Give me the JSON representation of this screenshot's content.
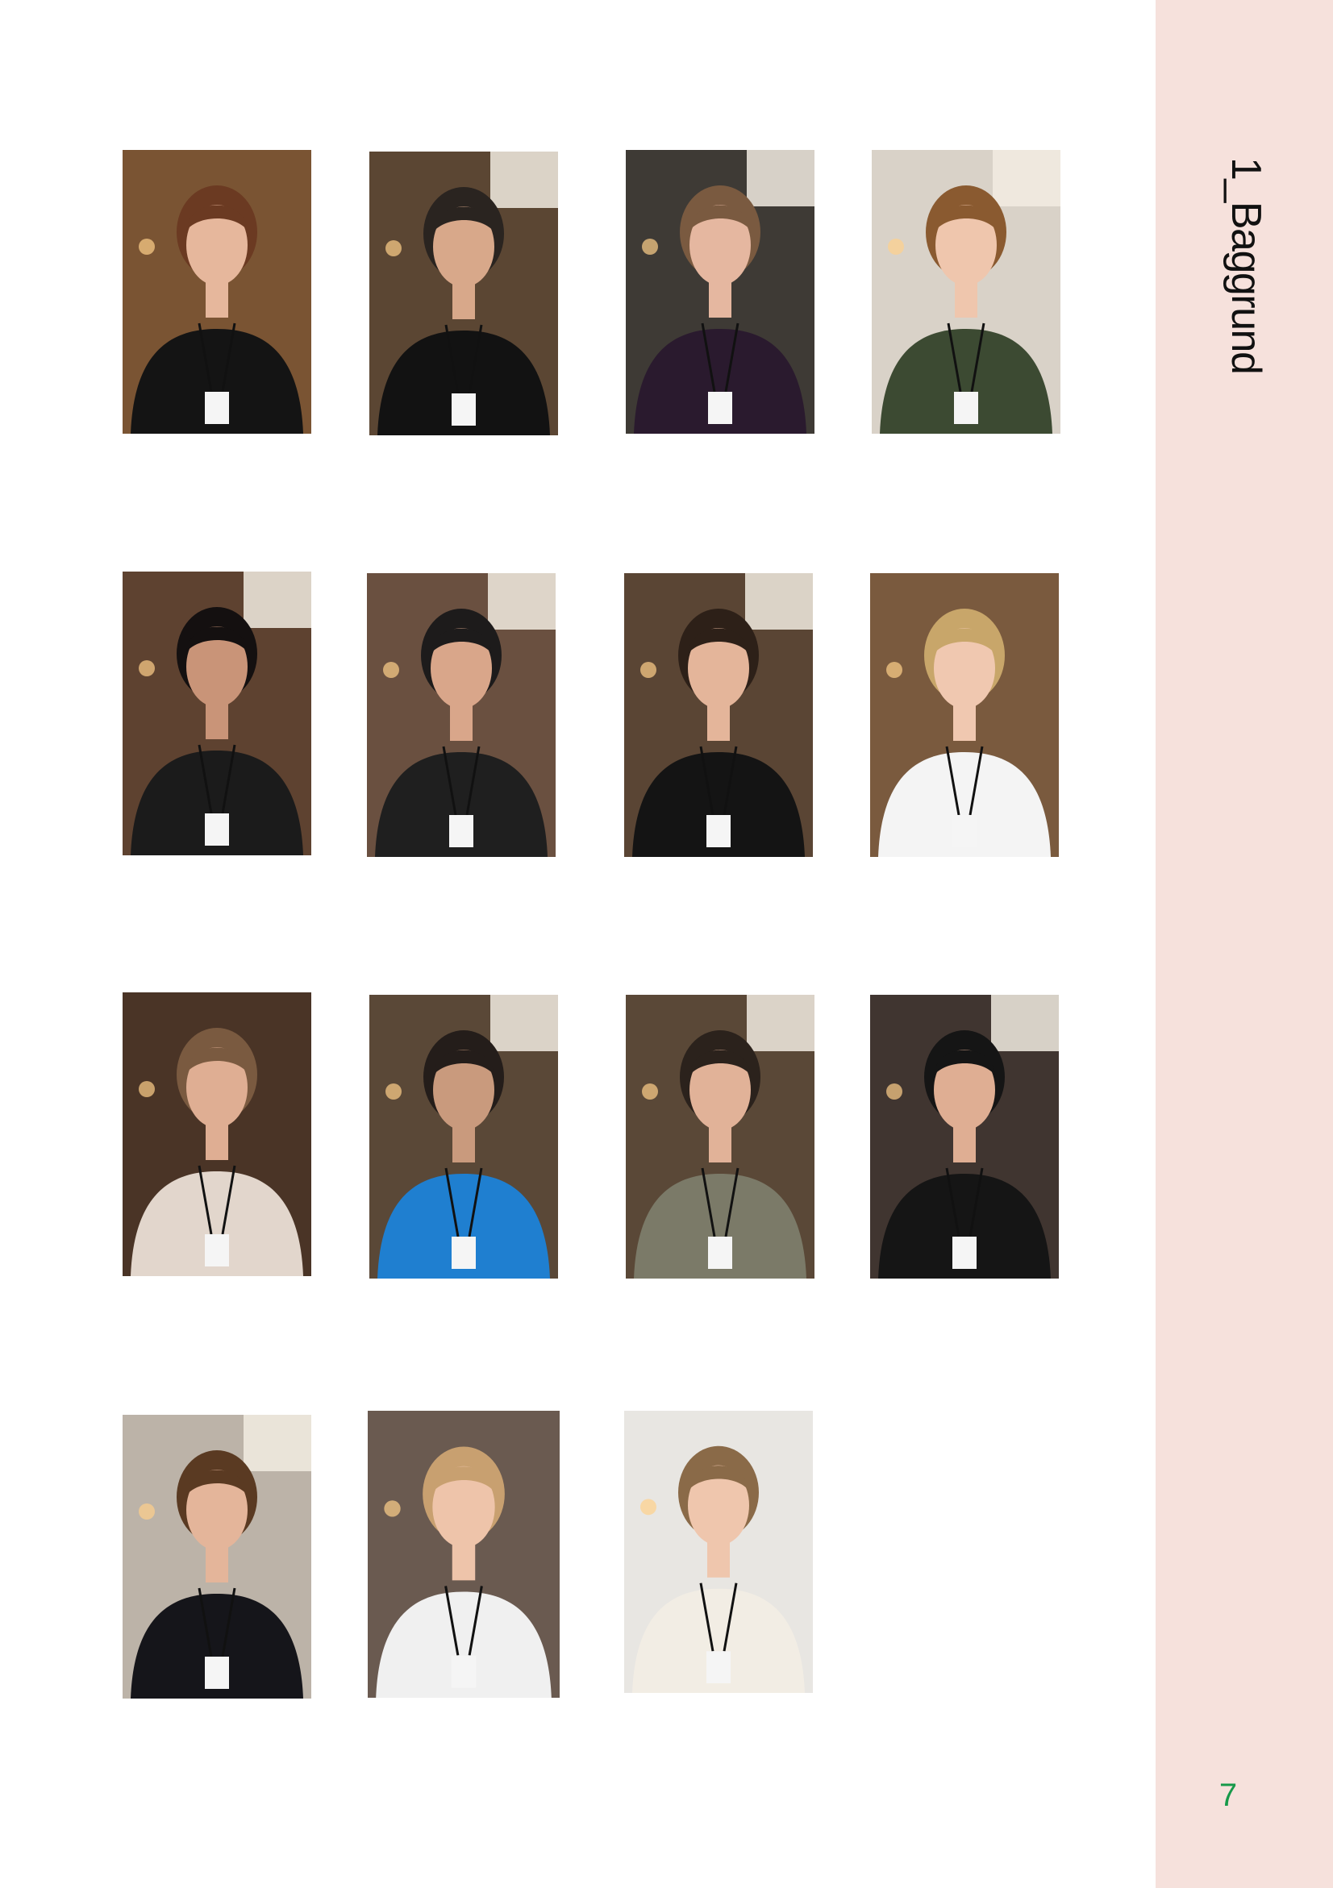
{
  "section_title": "1_Baggrund",
  "page_number": "7",
  "colors": {
    "sidebar": "#f6e1dc",
    "page_number": "#17994a"
  },
  "portraits": [
    {
      "bg": "#7a5433",
      "skin": "#e6b79c",
      "hair": "#6b3a22",
      "shirt": "#141414",
      "light": false
    },
    {
      "bg": "#5b4633",
      "skin": "#d8a88a",
      "hair": "#2a2420",
      "shirt": "#121212",
      "light": true
    },
    {
      "bg": "#3e3a35",
      "skin": "#e5b7a0",
      "hair": "#7a5a40",
      "shirt": "#2a1a2e",
      "light": true
    },
    {
      "bg": "#d9d2c8",
      "skin": "#efc6ad",
      "hair": "#8a5a30",
      "shirt": "#3c4a32",
      "light": true
    },
    {
      "bg": "#5e4230",
      "skin": "#c99478",
      "hair": "#141010",
      "shirt": "#1b1b1b",
      "light": true
    },
    {
      "bg": "#6a5040",
      "skin": "#d9a68a",
      "hair": "#1d1b1b",
      "shirt": "#1f1f1f",
      "light": true
    },
    {
      "bg": "#5a4534",
      "skin": "#e4b59a",
      "hair": "#2d2018",
      "shirt": "#141414",
      "light": true
    },
    {
      "bg": "#7a5a3e",
      "skin": "#f0c8b0",
      "hair": "#c8a66a",
      "shirt": "#f4f4f4",
      "light": false
    },
    {
      "bg": "#4a3426",
      "skin": "#dfae93",
      "hair": "#7a5a40",
      "shirt": "#e2d6cc",
      "light": false
    },
    {
      "bg": "#5a4837",
      "skin": "#c99a7d",
      "hair": "#241d1a",
      "shirt": "#1f7fd0",
      "light": true
    },
    {
      "bg": "#5a4837",
      "skin": "#e1b298",
      "hair": "#2b221c",
      "shirt": "#7b7a68",
      "light": true
    },
    {
      "bg": "#403530",
      "skin": "#dfae93",
      "hair": "#151515",
      "shirt": "#151515",
      "light": true
    },
    {
      "bg": "#bcb3a8",
      "skin": "#e4b59a",
      "hair": "#5a3a22",
      "shirt": "#15151a",
      "light": true
    },
    {
      "bg": "#6a5a50",
      "skin": "#eec4aa",
      "hair": "#c8a070",
      "shirt": "#f0f0f0",
      "light": false
    },
    {
      "bg": "#e8e6e2",
      "skin": "#efc6ad",
      "hair": "#8a6a48",
      "shirt": "#f2ede4",
      "light": false
    }
  ]
}
